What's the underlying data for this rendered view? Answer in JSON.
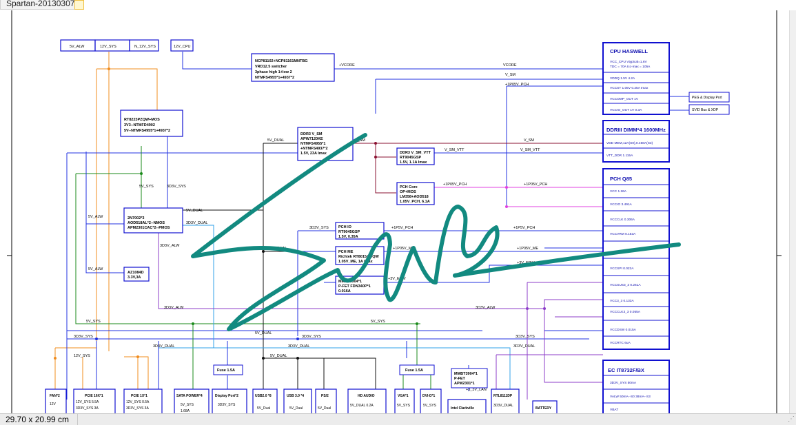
{
  "window": {
    "tab_title": "Spartan-20130307"
  },
  "status": {
    "page_size": "29.70 x 20.99 cm"
  },
  "colors": {
    "wire_blue": "#2030e0",
    "wire_orange": "#f08c1e",
    "wire_green": "#1a8a1a",
    "wire_maroon": "#8a1030",
    "wire_magenta": "#e040e0",
    "wire_purple": "#8c3cc8",
    "wire_cyan": "#30a0e8",
    "wire_black": "#111111",
    "signature": "#128a80",
    "box_border": "#1010d0"
  },
  "rails": {
    "v5_alw": "5V_ALW",
    "v12_sys": "12V_SYS",
    "n12_sys": "N_12V_SYS",
    "v12_cpu": "12V_CPU",
    "vcore_a": "+VCORE",
    "vcore_b": "VCORE",
    "vsm_a": "V_SM",
    "vsm_b": "V_SM",
    "vsm_c": "V_SM",
    "p1p05v_pch_a": "+1P05V_PCH",
    "v5_dual_a": "5V_DUAL",
    "v5_sys_a": "5V_SYS",
    "v3d3_sys_a": "3D3V_SYS",
    "v5_alw_b": "5V_ALW",
    "v5_dual_b": "5V_DUAL",
    "v3d3_dual_a": "3D3V_DUAL",
    "v3d3_alw_a": "3D3V_ALW",
    "v5_alw_c": "5V_ALW",
    "vsmvtt_a": "V_SM_VTT",
    "vsmvtt_b": "V_SM_VTT",
    "p1p05v_pch_b": "+1P05V_PCH",
    "p1p05v_pch_c": "+1P05V_PCH",
    "v3d3_sys_b": "3D3V_SYS",
    "p1p5v_pch_a": "+1P5V_PCH",
    "p1p5v_pch_b": "+1P5V_PCH",
    "v5_dual_c": "5V_DUAL",
    "p1p05v_me_a": "+1P05V_ME",
    "p1p05v_me_b": "+1P05V_ME",
    "p3v_epw_a": "+3V_EPW",
    "p3v_epw_b": "+3V_EPW",
    "v3d3_alw_b": "3D3V_ALW",
    "v3d3_alw_c": "3D3V_ALW",
    "v5_dual_d": "5V_DUAL",
    "v5_sys_b": "5V_SYS",
    "v5_sys_c": "5V_SYS",
    "v3d3_sys_c": "3D3V_SYS",
    "v3d3_sys_d": "3D3V_SYS",
    "v3d3_sys_e": "3D3V_SYS",
    "v3d3_dual_b": "3D3V_DUAL",
    "v3d3_dual_c": "3D3V_DUAL",
    "v3d3_dual_d": "3D3V_DUAL",
    "v12_sys_b": "12V_SYS",
    "v5_dual_e": "5V_DUAL",
    "p3_3v_lan": "+3_3V_LAN"
  },
  "blocks": {
    "vr12": [
      "NCP81102+NCP81161MNTBG",
      "VRD12.5 switcher",
      "3phase high 1+low 2",
      "NTMFS4955*1+4937*2"
    ],
    "rt8223": [
      "RT8223PZQW+MOS",
      "3V3--NTMFD4902",
      "5V--NTMFS4955*1+4937*2"
    ],
    "ddr3vsm": [
      "DDR3 V_SM",
      "APW7120KE",
      "NTMFS4955*1",
      "+NTMFS4937*2",
      "1.5V, 23A Imax"
    ],
    "ddr3vtt": [
      "DDR3 V_SM_VTT",
      "RT9045GSP",
      "1.5V, 1.1A Imax"
    ],
    "pchcore": [
      "PCH Core",
      "OP+MOS",
      "LM358+AOD518",
      "1.05V_PCH, 6.1A"
    ],
    "n7002": [
      "2N7002*3",
      "AOD518AL*2--NMOS",
      "APM2301CAC*2--PMOS"
    ],
    "az1084": [
      "AZ1084D",
      "3.3V,3A"
    ],
    "pchio": [
      "PCH IO",
      "RT9045GSP",
      "1.5V, 0.35A"
    ],
    "pchme": [
      "PCH ME",
      "Richtek RT8015AGQW",
      "1.05V_ME, 1A Imax"
    ],
    "mmbt1": [
      "MMBT3904*1",
      "P-FET  FDN340P*1",
      "0.016A"
    ],
    "mmbt2": [
      "MMBT3904*1",
      "P-FET",
      "APM2301*1"
    ]
  },
  "cpu": {
    "title": "CPU HASWELL",
    "rows": [
      "VCC_CPU Vtypical=1.6V",
      "TDC = 70A  Icc-max = 105A",
      "VDDQ 1.5V 4.2A",
      "VCCST 1.05V 0.25A Imax",
      "VCCOMP_OUT 1V",
      "VCCIO_OUT 1V 0.3A"
    ]
  },
  "cpu_side": {
    "peg": "PEG & Display Port",
    "svid": "SVID Bus & XDP"
  },
  "dimm": {
    "title": "DDRIII DIMM*4 1600MHz",
    "rows": [
      "VDD MEM,12A(S0),0.468A(S3)",
      "VTT_DDR 1.115A"
    ]
  },
  "pch": {
    "title": "PCH Q85",
    "rows": [
      "VCC    1.26A",
      "VCCIO   3.491A",
      "VCCCLK   0.306A",
      "VCCVRM   0.153A",
      "",
      "VCCSPI   0.022A",
      "VCCSUS3_3   0.261A",
      "VCC3_3   0.133A",
      "VCCCLK3_3   0.055A",
      "VCCDSW   0.015A",
      "VCCRTC 6uA"
    ]
  },
  "ec": {
    "title": "EC IT8732F/BX",
    "rows": [
      "3D3V_SYS   50mA",
      "VALW   50mA--S0  38mA--S3",
      "VBAT"
    ]
  },
  "fuses": {
    "dp": "Fuse 1.5A",
    "vga": "Fuse 1.5A"
  },
  "bottom": [
    {
      "name": "FAN*2",
      "l1": "12V",
      "l2": ""
    },
    {
      "name": "PCIE 16X*1",
      "l1": "12V_SYS       5.5A",
      "l2": "3D3V_SYS      3A"
    },
    {
      "name": "PCIE 1X*1",
      "l1": "12V_SYS       0.5A",
      "l2": "3D3V_SYS      3A"
    },
    {
      "name": "SATA POWER*4",
      "l1": "5V_SYS",
      "l2": "1.68A"
    },
    {
      "name": "Display Port*2",
      "l1": "3D3V_SYS",
      "l2": ""
    },
    {
      "name": "USB2.0 *8",
      "l1": "5V_Dual",
      "l2": ""
    },
    {
      "name": "USB 3.0 *4",
      "l1": "5V_Dual",
      "l2": ""
    },
    {
      "name": "PS/2",
      "l1": "5V_Dual",
      "l2": ""
    },
    {
      "name": "HD AUDIO",
      "l1": "5V_DUAL      0.2A",
      "l2": ""
    },
    {
      "name": "VGA*1",
      "l1": "5V_SYS",
      "l2": ""
    },
    {
      "name": "DVI-D*1",
      "l1": "5V_SYS",
      "l2": ""
    },
    {
      "name": "Intel Clarkville",
      "l1": "",
      "l2": ""
    },
    {
      "name": "RTL8111DP",
      "l1": "3D3V_DUAL",
      "l2": ""
    },
    {
      "name": "BATTERY",
      "l1": "",
      "l2": ""
    }
  ]
}
